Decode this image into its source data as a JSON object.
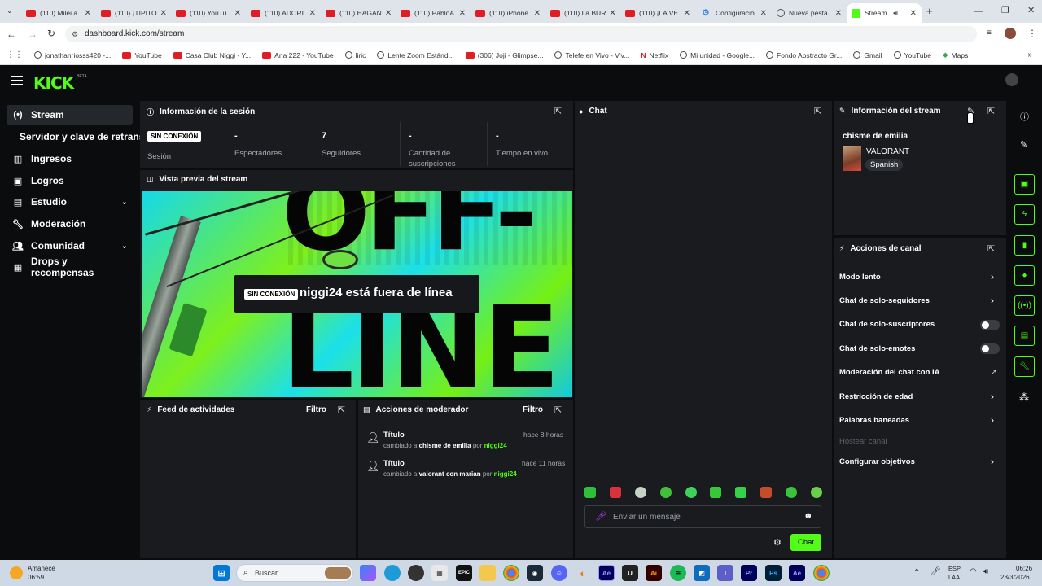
{
  "tabs": [
    {
      "label": "(110) Milei a"
    },
    {
      "label": "(110) ¡TIPITO"
    },
    {
      "label": "(110) YouTu"
    },
    {
      "label": "(110) ADORI"
    },
    {
      "label": "(110) HAGAN"
    },
    {
      "label": "(110) PabloA"
    },
    {
      "label": "(110) iPhone"
    },
    {
      "label": "(110) La BUR"
    },
    {
      "label": "(110) ¡LA VE"
    },
    {
      "label": "Configuració"
    },
    {
      "label": "Nueva pesta"
    },
    {
      "label": "Stream"
    }
  ],
  "address": {
    "url": "dashboard.kick.com/stream"
  },
  "bookmarks": [
    "jonathanriosss420 -...",
    "YouTube",
    "Casa Club Niggi - Y...",
    "Ana 222 - YouTube",
    "liric",
    "Lente Zoom Estánd...",
    "(306) Joji - Glimpse...",
    "Telefe en Vivo - Viv...",
    "Netflix",
    "Mi unidad - Google...",
    "Fondo Abstracto Gr...",
    "Gmail",
    "YouTube",
    "Maps"
  ],
  "brand": {
    "logo": "KICK",
    "beta": "BETA",
    "accent": "#53fc18"
  },
  "sidebar": {
    "items": [
      {
        "label": "Stream"
      },
      {
        "label": "Servidor y clave de retransmisión"
      },
      {
        "label": "Ingresos"
      },
      {
        "label": "Logros"
      },
      {
        "label": "Estudio"
      },
      {
        "label": "Moderación"
      },
      {
        "label": "Comunidad"
      },
      {
        "label": "Drops y recompensas"
      }
    ]
  },
  "session": {
    "title": "Información de la sesión",
    "status": "SIN CONEXIÓN",
    "status_label": "Sesión",
    "stats": [
      {
        "value": "-",
        "label": "Espectadores"
      },
      {
        "value": "7",
        "label": "Seguidores"
      },
      {
        "value": "-",
        "label": "Cantidad de suscripciones"
      },
      {
        "value": "-",
        "label": "Tiempo en vivo"
      }
    ]
  },
  "preview": {
    "title": "Vista previa del stream",
    "badge": "SIN CONEXIÓN",
    "message": "niggi24 está fuera de línea",
    "bg_text_1": "OFF-",
    "bg_text_2": "LINE"
  },
  "feed": {
    "title": "Feed de actividades",
    "filter": "Filtro"
  },
  "modactions": {
    "title": "Acciones de moderador",
    "filter": "Filtro",
    "items": [
      {
        "title": "Título",
        "time": "hace 8 horas",
        "prefix": "cambiado a",
        "value": "chisme de emilia",
        "by": "por",
        "user": "niggi24"
      },
      {
        "title": "Título",
        "time": "hace 11 horas",
        "prefix": "cambiado a",
        "value": "valorant con marian",
        "by": "por",
        "user": "niggi24"
      }
    ]
  },
  "chat": {
    "title": "Chat",
    "placeholder": "Enviar un mensaje",
    "send_label": "Chat"
  },
  "streaminfo": {
    "title": "Información del stream",
    "stream_title": "chisme de emilia",
    "category": "VALORANT",
    "language": "Spanish"
  },
  "channel": {
    "title": "Acciones de canal",
    "rows": [
      {
        "label": "Modo lento"
      },
      {
        "label": "Chat de solo-seguidores"
      },
      {
        "label": "Chat de solo-suscriptores"
      },
      {
        "label": "Chat de solo-emotes"
      },
      {
        "label": "Moderación del chat con IA"
      },
      {
        "label": "Restricción de edad"
      },
      {
        "label": "Palabras baneadas"
      },
      {
        "label": "Hostear canal"
      },
      {
        "label": "Configurar objetivos"
      }
    ]
  },
  "taskbar": {
    "weather": "Amanece",
    "weather_time": "06:59",
    "search": "Buscar",
    "lang": "ESP",
    "lang2": "LAA",
    "clock": "06:26",
    "date": "23/3/2026"
  }
}
